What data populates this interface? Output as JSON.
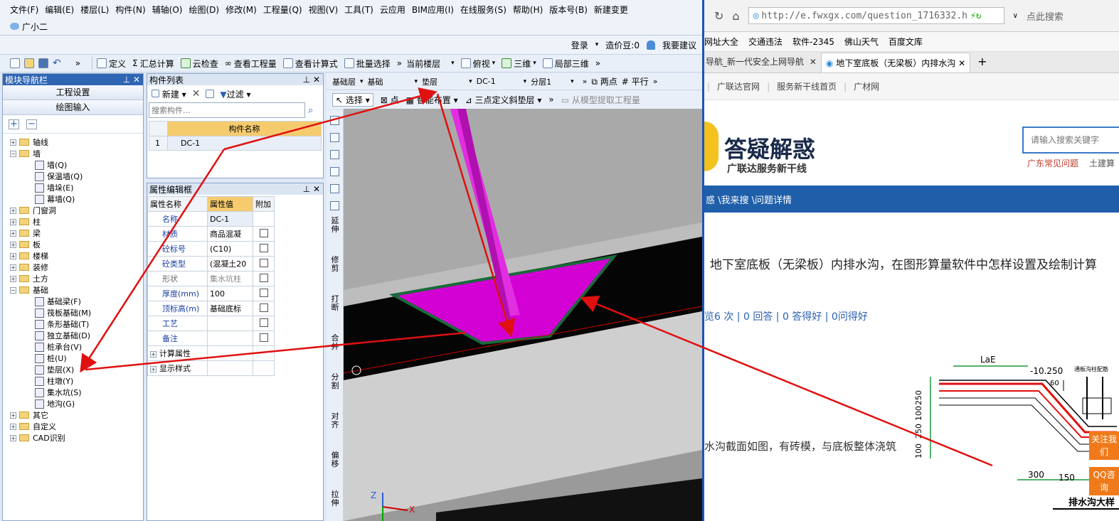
{
  "menu": {
    "items": [
      "文件(F)",
      "编辑(E)",
      "楼层(L)",
      "构件(N)",
      "辅轴(O)",
      "绘图(D)",
      "修改(M)",
      "工程量(Q)",
      "视图(V)",
      "工具(T)",
      "云应用",
      "BIM应用(I)",
      "在线服务(S)",
      "帮助(H)",
      "版本号(B)",
      "新建变更"
    ],
    "assistant": "广小二"
  },
  "header": {
    "login": "登录",
    "points": "造价豆:0",
    "suggest": "我要建议"
  },
  "toolbar": {
    "define": "定义",
    "calc": "汇总计算",
    "cloud_check": "云检查",
    "view_qty": "查看工程量",
    "view_formula": "查看计算式",
    "batch_select": "批量选择",
    "current_floor": "当前楼层",
    "view_mode": "俯视",
    "three_d": "三维",
    "local_3d": "局部三维"
  },
  "nav": {
    "title": "模块导航栏",
    "btn_project": "工程设置",
    "btn_draw": "绘图输入",
    "tree": [
      {
        "label": "轴线",
        "lvl": 0,
        "t": "f"
      },
      {
        "label": "墙",
        "lvl": 0,
        "t": "fo"
      },
      {
        "label": "墙(Q)",
        "lvl": 1
      },
      {
        "label": "保温墙(Q)",
        "lvl": 1
      },
      {
        "label": "墙垛(E)",
        "lvl": 1
      },
      {
        "label": "幕墙(Q)",
        "lvl": 1
      },
      {
        "label": "门窗洞",
        "lvl": 0,
        "t": "f"
      },
      {
        "label": "柱",
        "lvl": 0,
        "t": "f"
      },
      {
        "label": "梁",
        "lvl": 0,
        "t": "f"
      },
      {
        "label": "板",
        "lvl": 0,
        "t": "f"
      },
      {
        "label": "楼梯",
        "lvl": 0,
        "t": "f"
      },
      {
        "label": "装修",
        "lvl": 0,
        "t": "f"
      },
      {
        "label": "土方",
        "lvl": 0,
        "t": "f"
      },
      {
        "label": "基础",
        "lvl": 0,
        "t": "fo"
      },
      {
        "label": "基础梁(F)",
        "lvl": 1
      },
      {
        "label": "筏板基础(M)",
        "lvl": 1
      },
      {
        "label": "条形基础(T)",
        "lvl": 1
      },
      {
        "label": "独立基础(D)",
        "lvl": 1
      },
      {
        "label": "桩承台(V)",
        "lvl": 1
      },
      {
        "label": "桩(U)",
        "lvl": 1
      },
      {
        "label": "垫层(X)",
        "lvl": 1
      },
      {
        "label": "柱墩(Y)",
        "lvl": 1
      },
      {
        "label": "集水坑(S)",
        "lvl": 1
      },
      {
        "label": "地沟(G)",
        "lvl": 1
      },
      {
        "label": "其它",
        "lvl": 0,
        "t": "f"
      },
      {
        "label": "自定义",
        "lvl": 0,
        "t": "f"
      },
      {
        "label": "CAD识别",
        "lvl": 0,
        "t": "f"
      }
    ]
  },
  "complist": {
    "title": "构件列表",
    "new": "新建",
    "filter": "过滤",
    "search_placeholder": "搜索构件...",
    "col_name": "构件名称",
    "rows": [
      {
        "n": "1",
        "name": "DC-1"
      }
    ]
  },
  "props": {
    "title": "属性编辑框",
    "h_name": "属性名称",
    "h_val": "属性值",
    "h_add": "附加",
    "rows": [
      {
        "k": "名称",
        "v": "DC-1",
        "c": false
      },
      {
        "k": "材质",
        "v": "商品混凝",
        "c": true
      },
      {
        "k": "砼标号",
        "v": "(C10)",
        "c": true
      },
      {
        "k": "砼类型",
        "v": "(混凝土20",
        "c": true
      },
      {
        "k": "形状",
        "v": "集水坑柱",
        "c": true
      },
      {
        "k": "厚度(mm)",
        "v": "100",
        "c": true
      },
      {
        "k": "顶标高(m)",
        "v": "基础底标",
        "c": true
      },
      {
        "k": "工艺",
        "v": "",
        "c": true
      },
      {
        "k": "备注",
        "v": "",
        "c": true
      }
    ],
    "calc": "计算属性",
    "display": "显示样式"
  },
  "view": {
    "layer1": "基础层",
    "layer2": "基础",
    "layer3": "垫层",
    "comp": "DC-1",
    "sub": "分层1",
    "two_point": "两点",
    "parallel": "平行",
    "select": "选择",
    "point": "点",
    "smart": "智能布置",
    "three_point": "三点定义斜垫层",
    "extract": "从模型提取工程量",
    "side_tools": [
      "延伸",
      "修剪",
      "打断",
      "合并",
      "分割",
      "对齐",
      "偏移",
      "拉伸"
    ]
  },
  "browser": {
    "url": "http://e.fwxgx.com/question_1716332.h",
    "search_box": "点此搜索",
    "bookmarks": [
      "网址大全",
      "交通违法",
      "软件-2345",
      "佛山天气",
      "百度文库"
    ],
    "tab1": "导航_新一代安全上网导航",
    "tab2": "地下室底板（无梁板）内排水沟",
    "links": [
      "广联达官网",
      "服务新干线首页",
      "广材网"
    ],
    "logo_title": "答疑解惑",
    "logo_sub": "广联达服务新干线",
    "site_search": "请输入搜索关键字",
    "side_links": [
      "广东常见问题",
      "土建算"
    ],
    "breadcrumb": "惑 \\我来搜 \\问题详情",
    "question": "地下室底板（无梁板）内排水沟，在图形算量软件中怎样设置及绘制计算",
    "stats": "览6 次 | 0 回答 | 0 答得好 | 0问得好",
    "desc": "水沟截面如图，有砖模，与底板整体浇筑",
    "follow": "关注我们",
    "qq": "QQ咨询",
    "drawing": {
      "lae": "LaE",
      "elev": "-10.250",
      "d1": "250",
      "d2": "100",
      "d3": "250",
      "d4": "100",
      "w1": "300",
      "w2": "150",
      "n60": "60",
      "caption": "排水沟大样",
      "note": "通板沟柱配筋"
    }
  }
}
